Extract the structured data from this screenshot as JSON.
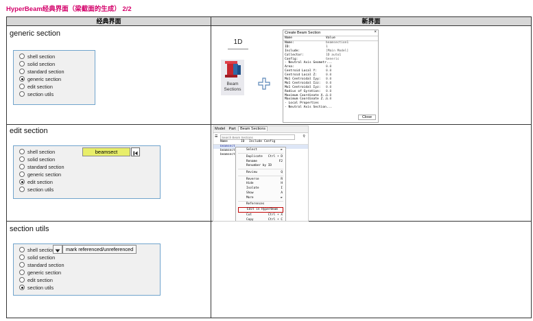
{
  "title": "HyperBeam经典界面（梁截面的生成） 2/2",
  "headers": {
    "classic": "经典界面",
    "new": "新界面"
  },
  "radio_labels": [
    "shell section",
    "solid section",
    "standard section",
    "generic section",
    "edit section",
    "section utils"
  ],
  "rows": [
    {
      "caption": "generic section",
      "selected": "generic section"
    },
    {
      "caption": "edit section",
      "selected": "edit section",
      "field_value": "beamsect"
    },
    {
      "caption": "section utils",
      "selected": "section utils",
      "button_label": "mark referenced/unreferenced"
    }
  ],
  "new_row1": {
    "tab_label": "1D",
    "icon_label": "Beam Sections",
    "dialog": {
      "title": "Create Beam Section",
      "col_name": "Name",
      "col_value": "Value",
      "rows": [
        {
          "name": "Name:",
          "value": "beamsection1"
        },
        {
          "name": "ID:",
          "value": "1"
        },
        {
          "name": "Include:",
          "value": "[Main Model]"
        },
        {
          "name": "Collector:",
          "value": "1D auto1"
        },
        {
          "name": "Config:",
          "value": "Generic"
        },
        {
          "name": "- Neutral Axis Geometr...",
          "value": ""
        },
        {
          "name": "Area:",
          "value": "0.0"
        },
        {
          "name": "Centroid Local Y:",
          "value": "0.0"
        },
        {
          "name": "Centroid Local Z:",
          "value": "0.0"
        },
        {
          "name": "Mo1 Centroidal Iyy:",
          "value": "0.0"
        },
        {
          "name": "Mo1 Centroidal Izz:",
          "value": "0.0"
        },
        {
          "name": "Mo1 Centroidal Iyz:",
          "value": "0.0"
        },
        {
          "name": "Radius of Gyration:",
          "value": "0.0"
        },
        {
          "name": "Maximum Coordinate X...",
          "value": "0.0"
        },
        {
          "name": "Maximum Coordinate Z...",
          "value": "0.0"
        },
        {
          "name": "- Local Properties",
          "value": ""
        },
        {
          "name": "- Neutral Axis Section...",
          "value": ""
        }
      ],
      "close_label": "Close"
    }
  },
  "new_row2": {
    "tabs": [
      "Model",
      "Part",
      "Beam Sections"
    ],
    "search_placeholder": "Search Beam Sections",
    "columns": [
      "Name",
      "ID",
      "Include",
      "Config"
    ],
    "items": [
      "beamsect",
      "beamsect",
      "beamsect"
    ],
    "menu": [
      {
        "label": "Select",
        "shortcut": "►"
      },
      {
        "label": "Duplicate",
        "shortcut": "Ctrl + D"
      },
      {
        "label": "Rename",
        "shortcut": "F2"
      },
      {
        "label": "Renumber by ID",
        "shortcut": ""
      },
      {
        "label": "Review",
        "shortcut": "Q"
      },
      {
        "label": "Reverse",
        "shortcut": "R"
      },
      {
        "label": "Hide",
        "shortcut": "H"
      },
      {
        "label": "Isolate",
        "shortcut": "I"
      },
      {
        "label": "Show",
        "shortcut": "A"
      },
      {
        "label": "More",
        "shortcut": "►"
      },
      {
        "label": "References",
        "shortcut": ""
      },
      {
        "label": "Edit in HyperBeam",
        "shortcut": ""
      },
      {
        "label": "Cut",
        "shortcut": "Ctrl + X"
      },
      {
        "label": "Copy",
        "shortcut": "Ctrl + C"
      }
    ]
  },
  "colors": {
    "title": "#d4006a",
    "panel_border": "#6fa3cc",
    "field": "#e8ee6a",
    "menu_highlight": "#c00000"
  }
}
